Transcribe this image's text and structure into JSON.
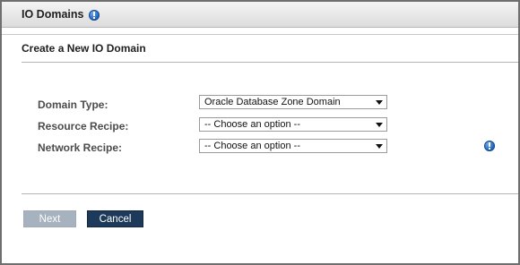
{
  "window": {
    "title": "IO Domains"
  },
  "section": {
    "title": "Create a New IO Domain"
  },
  "form": {
    "domain_type": {
      "label": "Domain Type:",
      "value": "Oracle Database Zone Domain"
    },
    "resource_recipe": {
      "label": "Resource Recipe:",
      "value": "-- Choose an option --"
    },
    "network_recipe": {
      "label": "Network Recipe:",
      "value": "-- Choose an option --"
    }
  },
  "buttons": {
    "next_label": "Next",
    "cancel_label": "Cancel"
  },
  "icons": {
    "title_info": "info-icon",
    "network_info": "info-icon",
    "dropdown": "chevron-down-icon"
  },
  "colors": {
    "primary_button": "#1e3a5a",
    "disabled_button": "#a7b2bf",
    "info_icon": "#1b5fb3"
  }
}
